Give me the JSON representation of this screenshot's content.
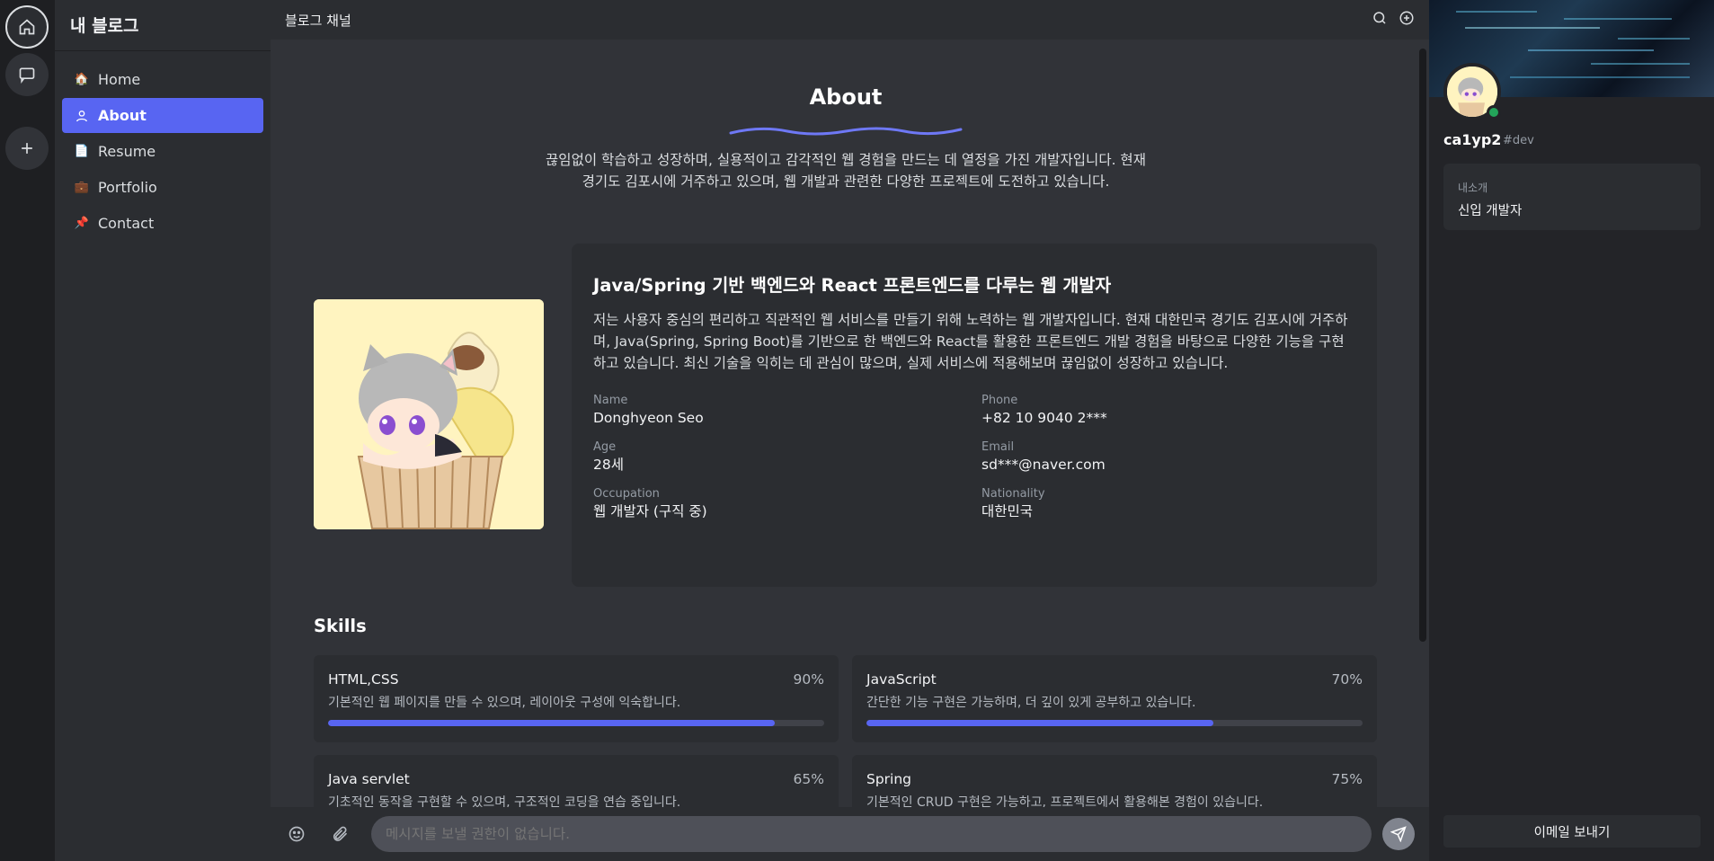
{
  "app": {
    "blog_name": "내 블로그",
    "channel_name": "블로그 채널"
  },
  "rail": {
    "items": [
      "home-icon",
      "chat-icon",
      "plus-icon"
    ]
  },
  "sidebar": {
    "items": [
      {
        "label": "Home",
        "icon": "house-icon"
      },
      {
        "label": "About",
        "icon": "user-icon",
        "active": true
      },
      {
        "label": "Resume",
        "icon": "document-icon"
      },
      {
        "label": "Portfolio",
        "icon": "briefcase-icon"
      },
      {
        "label": "Contact",
        "icon": "pushpin-icon"
      }
    ]
  },
  "header": {
    "icons": [
      "search-icon",
      "add-circle-icon"
    ]
  },
  "about": {
    "title": "About",
    "intro": "끊임없이 학습하고 성장하며, 실용적이고 감각적인 웹 경험을 만드는 데 열정을 가진 개발자입니다. 현재 경기도 김포시에 거주하고 있으며, 웹 개발과 관련한 다양한 프로젝트에 도전하고 있습니다.",
    "heading": "Java/Spring 기반 백엔드와 React 프론트엔드를 다루는 웹 개발자",
    "description": "저는 사용자 중심의 편리하고 직관적인 웹 서비스를 만들기 위해 노력하는 웹 개발자입니다. 현재 대한민국 경기도 김포시에 거주하며, Java(Spring, Spring Boot)를 기반으로 한 백엔드와 React를 활용한 프론트엔드 개발 경험을 바탕으로 다양한 기능을 구현하고 있습니다. 최신 기술을 익히는 데 관심이 많으며, 실제 서비스에 적용해보며 끊임없이 성장하고 있습니다.",
    "info": [
      {
        "label": "Name",
        "value": "Donghyeon Seo"
      },
      {
        "label": "Phone",
        "value": "+82 10 9040 2***"
      },
      {
        "label": "Age",
        "value": "28세"
      },
      {
        "label": "Email",
        "value": "sd***@naver.com"
      },
      {
        "label": "Occupation",
        "value": "웹 개발자 (구직 중)"
      },
      {
        "label": "Nationality",
        "value": "대한민국"
      }
    ]
  },
  "skills": {
    "title": "Skills",
    "items": [
      {
        "name": "HTML,CSS",
        "percent_label": "90%",
        "level": 90,
        "desc": "기본적인 웹 페이지를 만들 수 있으며, 레이아웃 구성에 익숙합니다."
      },
      {
        "name": "JavaScript",
        "percent_label": "70%",
        "level": 70,
        "desc": "간단한 기능 구현은 가능하며, 더 깊이 있게 공부하고 있습니다."
      },
      {
        "name": "Java servlet",
        "percent_label": "65%",
        "level": 65,
        "desc": "기초적인 동작을 구현할 수 있으며, 구조적인 코딩을 연습 중입니다."
      },
      {
        "name": "Spring",
        "percent_label": "75%",
        "level": 75,
        "desc": "기본적인 CRUD 구현은 가능하고, 프로젝트에서 활용해본 경험이 있습니다."
      }
    ]
  },
  "input": {
    "placeholder": "메시지를 보낼 권한이 없습니다."
  },
  "user_panel": {
    "username": "ca1yp2",
    "tag": "#dev",
    "bio_label": "내소개",
    "bio_value": "신입 개발자",
    "email_button": "이메일 보내기"
  },
  "colors": {
    "accent": "#5865f2",
    "online": "#23a55a"
  }
}
